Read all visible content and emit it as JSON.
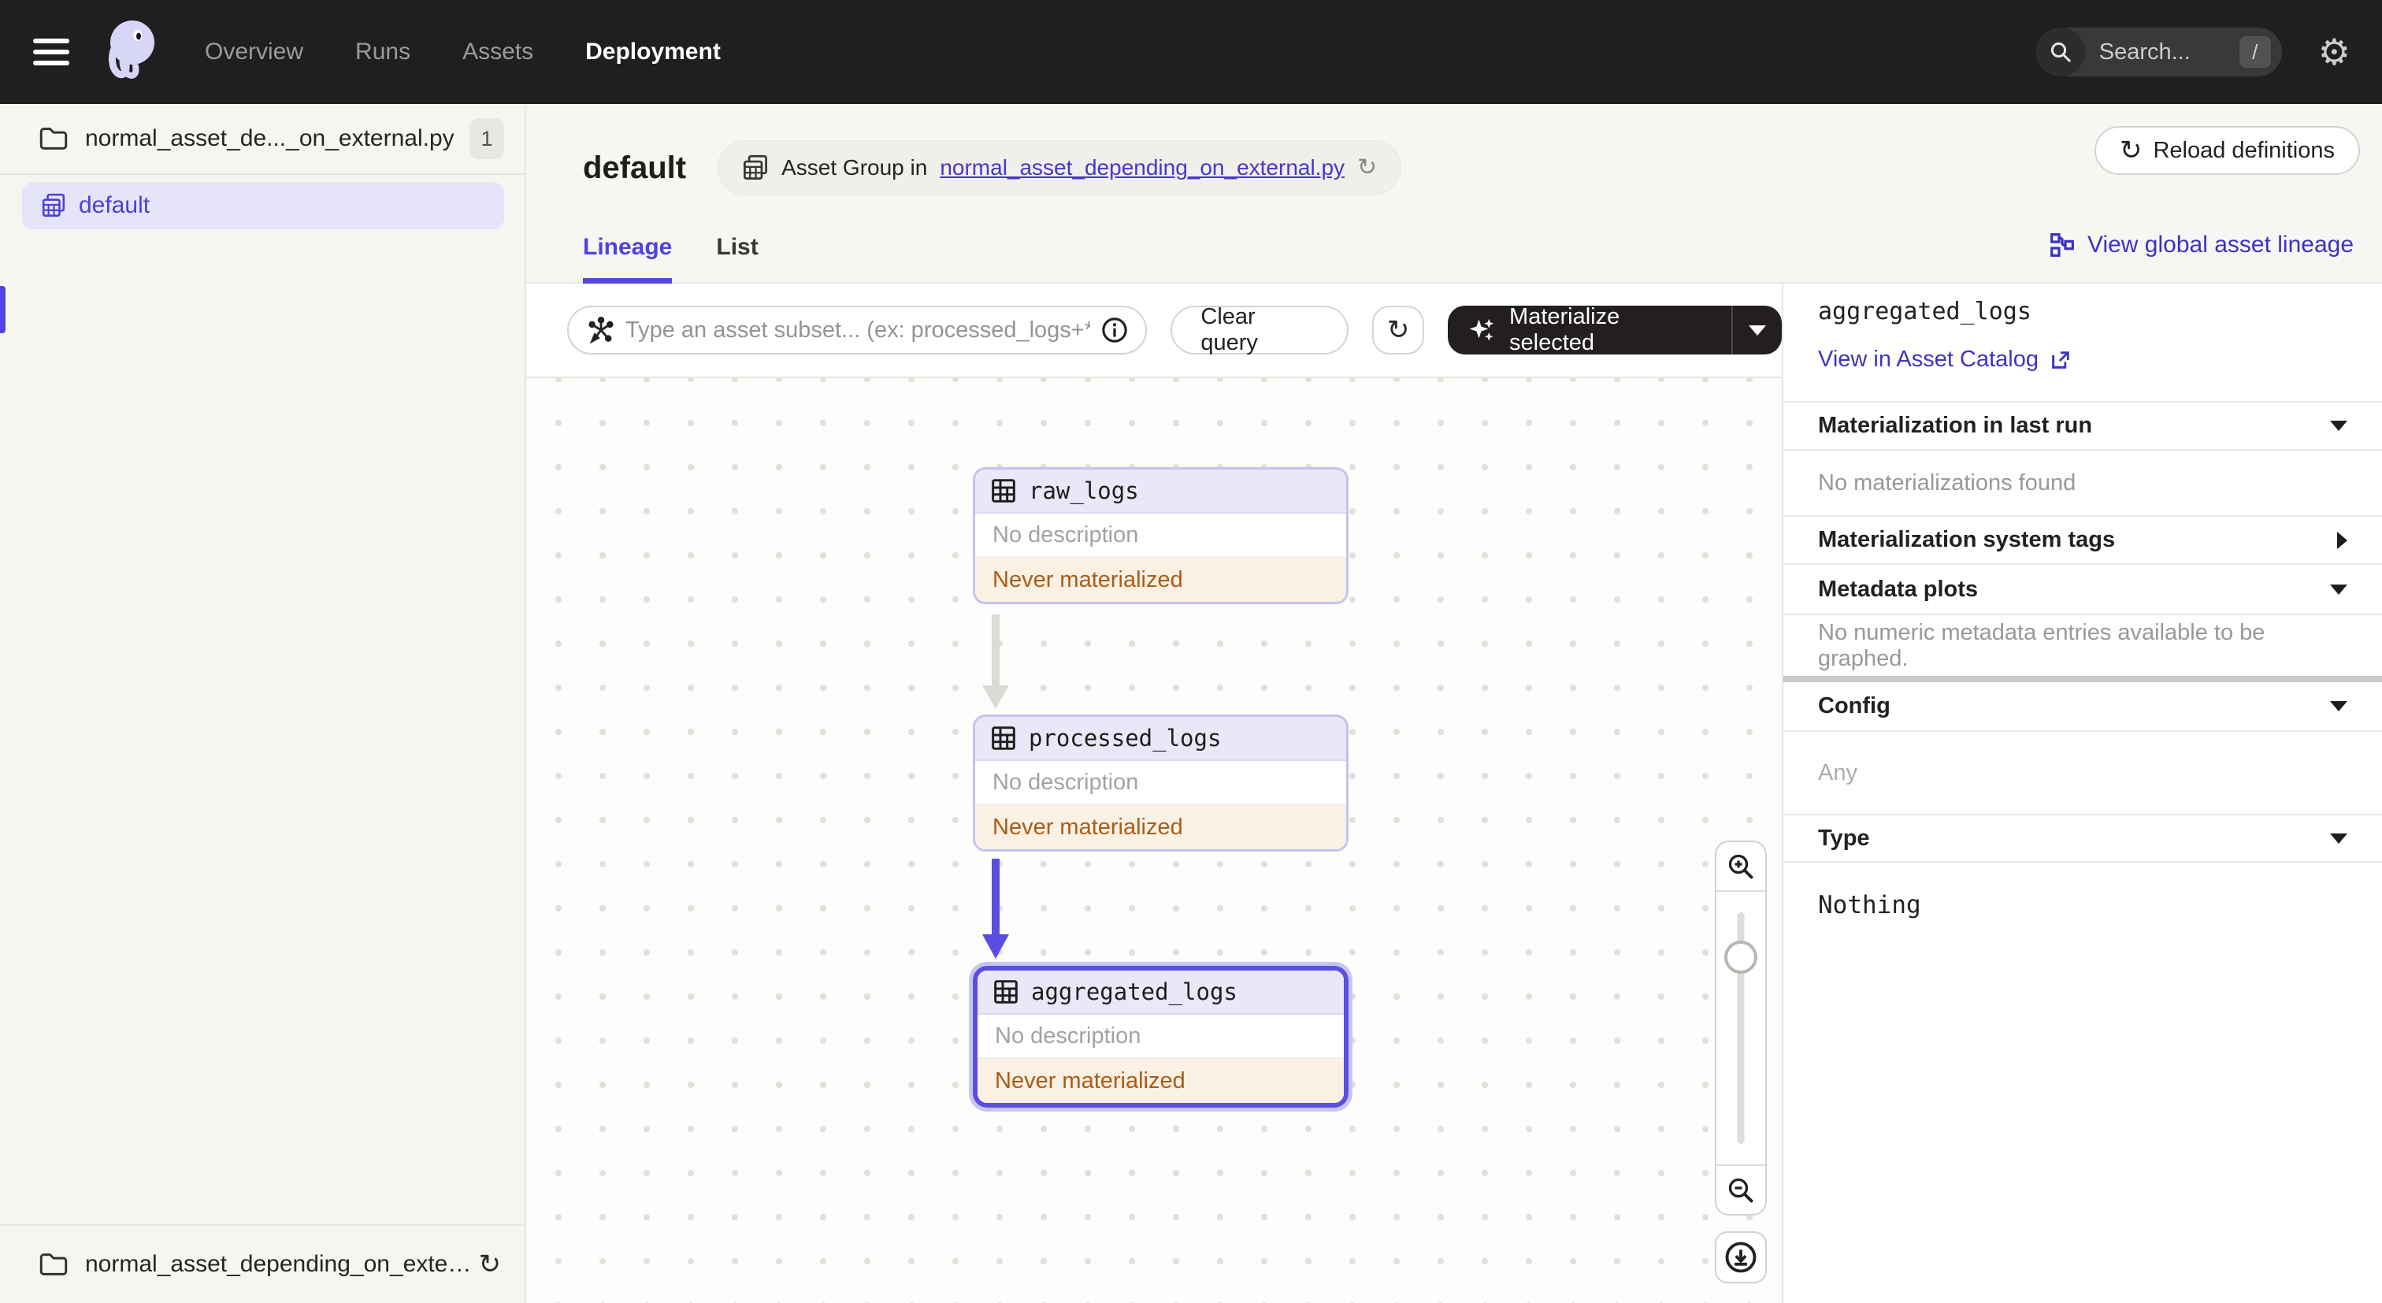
{
  "colors": {
    "accent": "#4F43DD",
    "nav_bg": "#211E1F",
    "link": "#4538C9",
    "node_border": "#C6C2EF",
    "node_selected_border": "#5B4EE0",
    "node_header_bg": "#E9E7F8",
    "status_text": "#A95D18",
    "status_bg": "#FAF0E3",
    "edge_gray": "#DCDAD6",
    "edge_purple": "#5A4DE1"
  },
  "topnav": {
    "items": [
      {
        "label": "Overview",
        "active": false
      },
      {
        "label": "Runs",
        "active": false
      },
      {
        "label": "Assets",
        "active": false
      },
      {
        "label": "Deployment",
        "active": true
      }
    ],
    "search": {
      "placeholder": "Search...",
      "shortcut": "/"
    },
    "icons": {
      "gear": "⚙",
      "refresh": "↻"
    }
  },
  "sidebar": {
    "group_file": {
      "label": "normal_asset_de..._on_external.py",
      "badge": "1"
    },
    "items": [
      {
        "label": "default",
        "selected": true
      }
    ],
    "footer": {
      "label": "normal_asset_depending_on_extern..."
    }
  },
  "header": {
    "title": "default",
    "breadcrumb_prefix": "Asset Group in",
    "breadcrumb_link": "normal_asset_depending_on_external.py",
    "reload_button": "Reload definitions"
  },
  "tabs": {
    "items": [
      {
        "label": "Lineage",
        "active": true
      },
      {
        "label": "List",
        "active": false
      }
    ],
    "global_lineage_link": "View global asset lineage"
  },
  "toolbar": {
    "query_placeholder": "Type an asset subset... (ex: processed_logs+*)",
    "clear_button": "Clear query",
    "materialize_button": "Materialize selected"
  },
  "graph": {
    "nodes": [
      {
        "name": "raw_logs",
        "description": "No description",
        "status": "Never materialized",
        "selected": false
      },
      {
        "name": "processed_logs",
        "description": "No description",
        "status": "Never materialized",
        "selected": false
      },
      {
        "name": "aggregated_logs",
        "description": "No description",
        "status": "Never materialized",
        "selected": true
      }
    ],
    "edges": [
      {
        "from": "raw_logs",
        "to": "processed_logs",
        "highlighted": false
      },
      {
        "from": "processed_logs",
        "to": "aggregated_logs",
        "highlighted": true
      }
    ]
  },
  "detail_panel": {
    "title": "aggregated_logs",
    "catalog_link": "View in Asset Catalog",
    "sections": {
      "materialization_last_run": {
        "header": "Materialization in last run",
        "body": "No materializations found",
        "expanded": true
      },
      "materialization_system_tags": {
        "header": "Materialization system tags",
        "expanded": false
      },
      "metadata_plots": {
        "header": "Metadata plots",
        "body": "No numeric metadata entries available to be graphed.",
        "expanded": true
      },
      "config": {
        "header": "Config",
        "body": "Any",
        "expanded": true
      },
      "type": {
        "header": "Type",
        "body": "Nothing",
        "expanded": true
      }
    }
  }
}
